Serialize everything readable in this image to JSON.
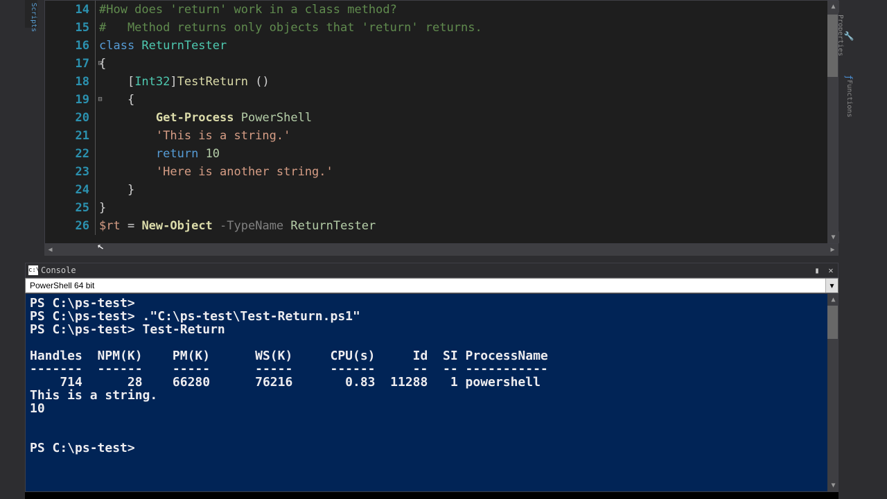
{
  "left_tab": "Scripts",
  "right_tabs": [
    "Properties",
    "Functions"
  ],
  "gutter_start": 14,
  "code_lines": [
    [
      [
        "c-comment",
        "#How does 'return' work in a class method?"
      ]
    ],
    [
      [
        "c-comment",
        "#   Method returns only objects that 'return' returns."
      ]
    ],
    [
      [
        "c-keyword",
        "class "
      ],
      [
        "c-type",
        "ReturnTester"
      ]
    ],
    [
      [
        "c-plain",
        "{"
      ]
    ],
    [
      [
        "c-plain",
        "    ["
      ],
      [
        "c-type",
        "Int32"
      ],
      [
        "c-plain",
        "]"
      ],
      [
        "c-ident",
        "TestReturn"
      ],
      [
        "c-plain",
        " ()"
      ]
    ],
    [
      [
        "c-plain",
        "    {"
      ]
    ],
    [
      [
        "c-plain",
        "        "
      ],
      [
        "c-cmdlet",
        "Get-Process"
      ],
      [
        "c-plain",
        " "
      ],
      [
        "c-arg",
        "PowerShell"
      ]
    ],
    [
      [
        "c-plain",
        "        "
      ],
      [
        "c-string",
        "'This is a string.'"
      ]
    ],
    [
      [
        "c-plain",
        "        "
      ],
      [
        "c-keyword",
        "return"
      ],
      [
        "c-plain",
        " "
      ],
      [
        "c-num",
        "10"
      ]
    ],
    [
      [
        "c-plain",
        "        "
      ],
      [
        "c-string",
        "'Here is another string.'"
      ]
    ],
    [
      [
        "c-plain",
        "    }"
      ]
    ],
    [
      [
        "c-plain",
        "}"
      ]
    ],
    [
      [
        "c-var",
        "$rt"
      ],
      [
        "c-plain",
        " = "
      ],
      [
        "c-cmdlet",
        "New-Object"
      ],
      [
        "c-plain",
        " "
      ],
      [
        "c-param",
        "-TypeName"
      ],
      [
        "c-plain",
        " "
      ],
      [
        "c-arg",
        "ReturnTester"
      ]
    ]
  ],
  "fold_marks": {
    "3": "⊟",
    "5": "⊟"
  },
  "console": {
    "title": "Console",
    "pin_icon": "📌",
    "close_icon": "✕",
    "select": "PowerShell 64 bit",
    "lines": [
      "PS C:\\ps-test>",
      "PS C:\\ps-test> .\"C:\\ps-test\\Test-Return.ps1\"",
      "PS C:\\ps-test> Test-Return",
      "",
      "Handles  NPM(K)    PM(K)      WS(K)     CPU(s)     Id  SI ProcessName",
      "-------  ------    -----      -----     ------     --  -- -----------",
      "    714      28    66280      76216       0.83  11288   1 powershell",
      "This is a string.",
      "10",
      "",
      "",
      "PS C:\\ps-test>"
    ]
  }
}
